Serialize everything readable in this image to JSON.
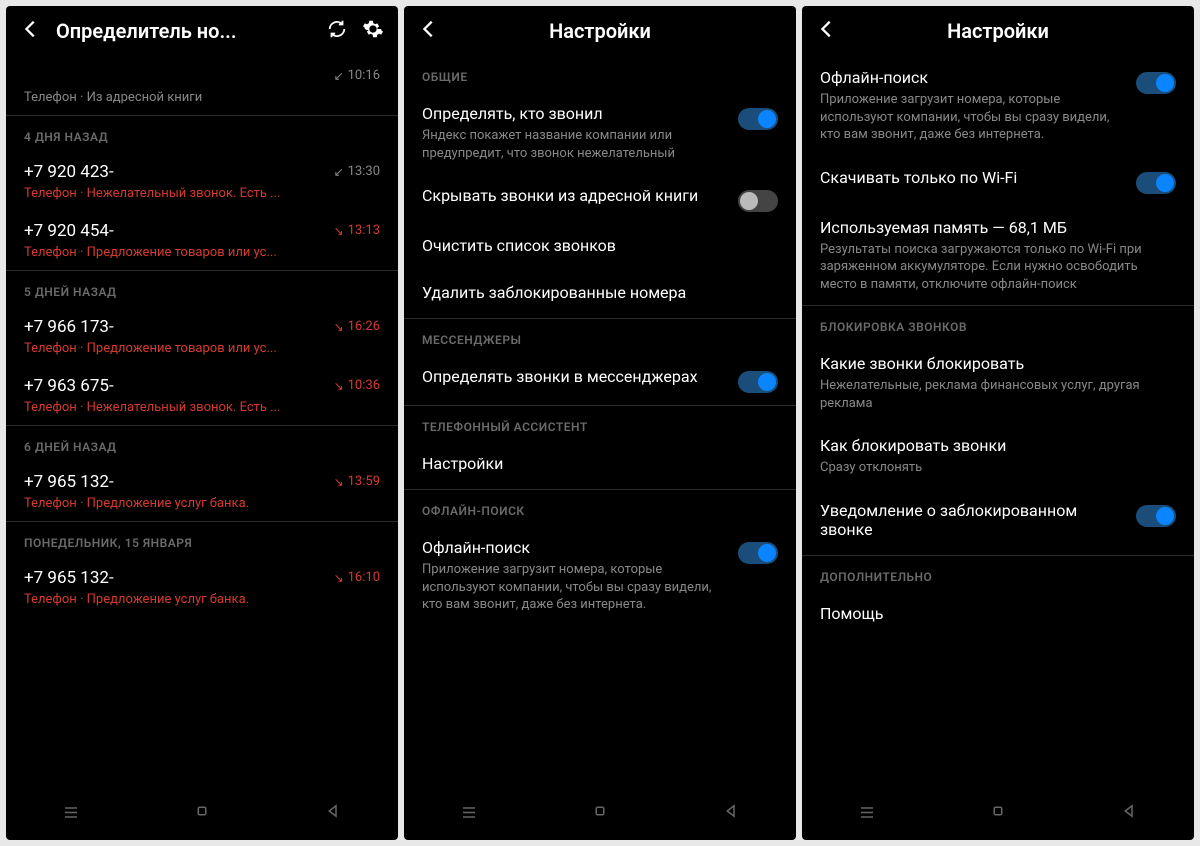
{
  "screen1": {
    "title": "Определитель но...",
    "first_item": {
      "sub": "Телефон · Из адресной книги",
      "time": "10:16"
    },
    "groups": [
      {
        "header": "4 ДНЯ НАЗАД",
        "calls": [
          {
            "number": "+7 920 423-",
            "sub": "Телефон · Нежелательный звонок. Есть ...",
            "time": "13:30",
            "red": true,
            "arrow": "↙"
          },
          {
            "number": "+7 920 454-",
            "sub": "Телефон · Предложение товаров или ус...",
            "time": "13:13",
            "red": true,
            "arrow": "↘"
          }
        ]
      },
      {
        "header": "5 ДНЕЙ НАЗАД",
        "calls": [
          {
            "number": "+7 966 173-",
            "sub": "Телефон · Предложение товаров или ус...",
            "time": "16:26",
            "red": true,
            "arrow": "↘"
          },
          {
            "number": "+7 963 675-",
            "sub": "Телефон · Нежелательный звонок. Есть ...",
            "time": "10:36",
            "red": true,
            "arrow": "↘"
          }
        ]
      },
      {
        "header": "6 ДНЕЙ НАЗАД",
        "calls": [
          {
            "number": "+7 965 132-",
            "sub": "Телефон · Предложение услуг банка.",
            "time": "13:59",
            "red": true,
            "arrow": "↘"
          }
        ]
      },
      {
        "header": "ПОНЕДЕЛЬНИК, 15 ЯНВАРЯ",
        "calls": [
          {
            "number": "+7 965 132-",
            "sub": "Телефон · Предложение услуг банка.",
            "time": "16:10",
            "red": true,
            "arrow": "↘"
          }
        ]
      }
    ]
  },
  "screen2": {
    "title": "Настройки",
    "sections": {
      "general": {
        "header": "ОБЩИЕ",
        "detect": {
          "title": "Определять, кто звонил",
          "desc": "Яндекс покажет название компании или предупредит, что звонок нежелательный"
        },
        "hide": {
          "title": "Скрывать звонки из адресной книги"
        },
        "clear": {
          "title": "Очистить список звонков"
        },
        "deleteBlocked": {
          "title": "Удалить заблокированные номера"
        }
      },
      "messengers": {
        "header": "МЕССЕНДЖЕРЫ",
        "detect": {
          "title": "Определять звонки в мессенджерах"
        }
      },
      "assistant": {
        "header": "ТЕЛЕФОННЫЙ АССИСТЕНТ",
        "settings": {
          "title": "Настройки"
        }
      },
      "offline": {
        "header": "ОФЛАЙН-ПОИСК",
        "search": {
          "title": "Офлайн-поиск",
          "desc": "Приложение загрузит номера, которые используют компании, чтобы вы сразу видели, кто вам звонит, даже без интернета."
        }
      }
    }
  },
  "screen3": {
    "title": "Настройки",
    "offline": {
      "search": {
        "title": "Офлайн-поиск",
        "desc": "Приложение загрузит номера, которые используют компании, чтобы вы сразу видели, кто вам звонит, даже без интернета."
      },
      "wifi": {
        "title": "Скачивать только по Wi-Fi"
      },
      "memory": {
        "title": "Используемая память — 68,1 МБ",
        "desc": "Результаты поиска загружаются только по Wi-Fi при заряженном аккумуляторе. Если нужно освободить место в памяти, отключите офлайн-поиск"
      }
    },
    "blocking": {
      "header": "БЛОКИРОВКА ЗВОНКОВ",
      "which": {
        "title": "Какие звонки блокировать",
        "desc": "Нежелательные, реклама финансовых услуг, другая реклама"
      },
      "how": {
        "title": "Как блокировать звонки",
        "desc": "Сразу отклонять"
      },
      "notify": {
        "title": "Уведомление о заблокированном звонке"
      }
    },
    "extra": {
      "header": "ДОПОЛНИТЕЛЬНО",
      "help": {
        "title": "Помощь"
      }
    }
  }
}
